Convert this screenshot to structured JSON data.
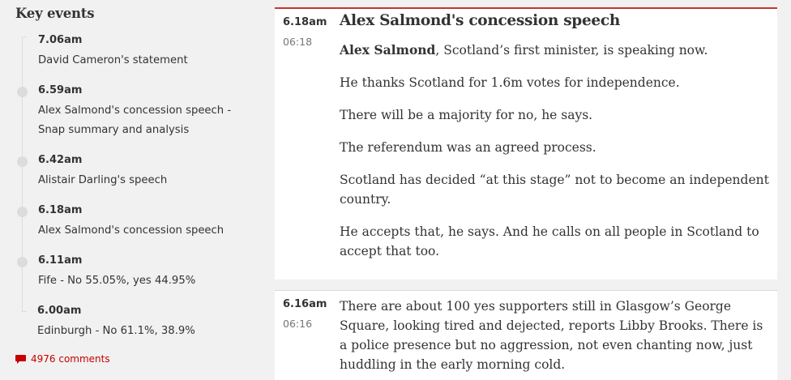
{
  "key_events": {
    "title": "Key events",
    "items": [
      {
        "time": "7.06am",
        "label": "David Cameron's statement"
      },
      {
        "time": "6.59am",
        "label": "Alex Salmond's concession speech - Snap summary and analysis"
      },
      {
        "time": "6.42am",
        "label": "Alistair Darling's speech"
      },
      {
        "time": "6.18am",
        "label": "Alex Salmond's concession speech"
      },
      {
        "time": "6.11am",
        "label": "Fife - No 55.05%, yes 44.95%"
      },
      {
        "time": "6.00am",
        "label": "Edinburgh - No 61.1%, 38.9%"
      }
    ],
    "comments": "4976 comments"
  },
  "blocks": [
    {
      "time": "6.18am",
      "time24": "06:18",
      "title": "Alex Salmond's concession speech",
      "lead_bold": "Alex Salmond",
      "lead_rest": ", Scotland’s first minister, is speaking now.",
      "paragraphs": [
        "He thanks Scotland for 1.6m votes for independence.",
        "There will be a majority for no, he says.",
        "The referendum was an agreed process.",
        "Scotland has decided “at this stage” not to become an independent country.",
        "He accepts that, he says. And he calls on all people in Scotland to accept that too."
      ]
    },
    {
      "time": "6.16am",
      "time24": "06:16",
      "text": "There are about 100 yes supporters still in Glasgow’s George Square, looking tired and dejected, reports Libby Brooks. There is a police presence but no aggression, not even chanting now, just huddling in the early morning cold."
    }
  ],
  "colors": {
    "accent_red": "#c70000",
    "block_top_border": "#c0392b",
    "timeline": "#dcdcdc",
    "background": "#f1f1f1"
  }
}
